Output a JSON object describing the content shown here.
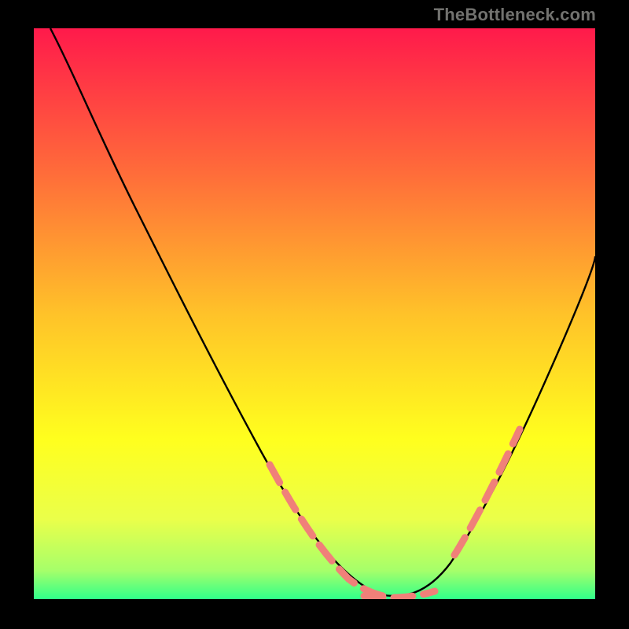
{
  "watermark": "TheBottleneck.com",
  "chart_data": {
    "type": "line",
    "title": "",
    "xlabel": "",
    "ylabel": "",
    "xlim": [
      0,
      100
    ],
    "ylim": [
      0,
      100
    ],
    "gradient_stops": [
      {
        "offset": 0,
        "color": "#ff1a4b"
      },
      {
        "offset": 0.25,
        "color": "#ff6b3a"
      },
      {
        "offset": 0.5,
        "color": "#ffc229"
      },
      {
        "offset": 0.72,
        "color": "#ffff1e"
      },
      {
        "offset": 0.86,
        "color": "#eaff4a"
      },
      {
        "offset": 0.95,
        "color": "#a6ff6a"
      },
      {
        "offset": 1.0,
        "color": "#30ff8a"
      }
    ],
    "series": [
      {
        "name": "bottleneck-curve",
        "color": "#000000",
        "x": [
          3,
          8,
          15,
          22,
          30,
          38,
          46,
          52,
          58,
          63,
          67,
          70,
          75,
          80,
          85,
          92,
          100
        ],
        "y": [
          100,
          90,
          76,
          62,
          47,
          33,
          20,
          11,
          5,
          2,
          1,
          2,
          8,
          18,
          30,
          44,
          60
        ]
      },
      {
        "name": "highlight-left",
        "color": "#f08079",
        "style": "dashed",
        "x": [
          46,
          52,
          58,
          63
        ],
        "y": [
          20,
          11,
          5,
          2
        ]
      },
      {
        "name": "highlight-bottom",
        "color": "#f08079",
        "style": "dashed",
        "x": [
          63,
          67,
          70
        ],
        "y": [
          2,
          1,
          2
        ]
      },
      {
        "name": "highlight-right",
        "color": "#f08079",
        "style": "dashed",
        "x": [
          75,
          80,
          85
        ],
        "y": [
          8,
          18,
          30
        ]
      }
    ]
  }
}
